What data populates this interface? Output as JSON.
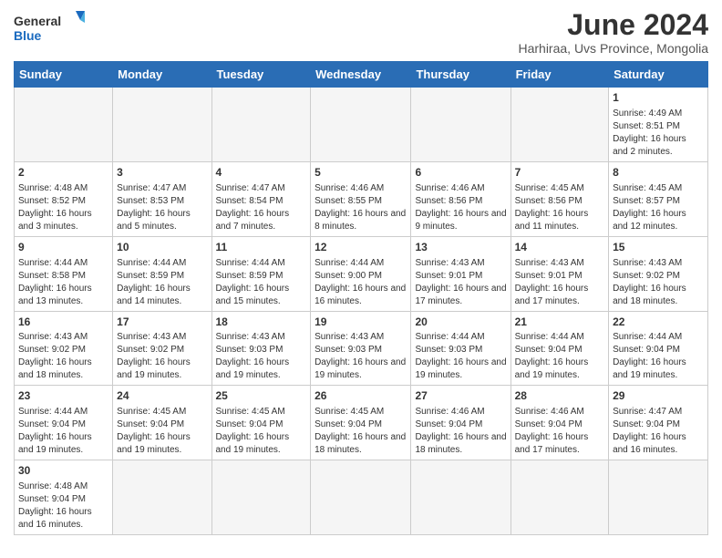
{
  "logo": {
    "text_general": "General",
    "text_blue": "Blue"
  },
  "title": "June 2024",
  "subtitle": "Harhiraa, Uvs Province, Mongolia",
  "days_of_week": [
    "Sunday",
    "Monday",
    "Tuesday",
    "Wednesday",
    "Thursday",
    "Friday",
    "Saturday"
  ],
  "weeks": [
    [
      {
        "day": "",
        "info": ""
      },
      {
        "day": "",
        "info": ""
      },
      {
        "day": "",
        "info": ""
      },
      {
        "day": "",
        "info": ""
      },
      {
        "day": "",
        "info": ""
      },
      {
        "day": "",
        "info": ""
      },
      {
        "day": "1",
        "info": "Sunrise: 4:49 AM\nSunset: 8:51 PM\nDaylight: 16 hours and 2 minutes."
      }
    ],
    [
      {
        "day": "2",
        "info": "Sunrise: 4:48 AM\nSunset: 8:52 PM\nDaylight: 16 hours and 3 minutes."
      },
      {
        "day": "3",
        "info": "Sunrise: 4:47 AM\nSunset: 8:53 PM\nDaylight: 16 hours and 5 minutes."
      },
      {
        "day": "4",
        "info": "Sunrise: 4:47 AM\nSunset: 8:54 PM\nDaylight: 16 hours and 7 minutes."
      },
      {
        "day": "5",
        "info": "Sunrise: 4:46 AM\nSunset: 8:55 PM\nDaylight: 16 hours and 8 minutes."
      },
      {
        "day": "6",
        "info": "Sunrise: 4:46 AM\nSunset: 8:56 PM\nDaylight: 16 hours and 9 minutes."
      },
      {
        "day": "7",
        "info": "Sunrise: 4:45 AM\nSunset: 8:56 PM\nDaylight: 16 hours and 11 minutes."
      },
      {
        "day": "8",
        "info": "Sunrise: 4:45 AM\nSunset: 8:57 PM\nDaylight: 16 hours and 12 minutes."
      }
    ],
    [
      {
        "day": "9",
        "info": "Sunrise: 4:44 AM\nSunset: 8:58 PM\nDaylight: 16 hours and 13 minutes."
      },
      {
        "day": "10",
        "info": "Sunrise: 4:44 AM\nSunset: 8:59 PM\nDaylight: 16 hours and 14 minutes."
      },
      {
        "day": "11",
        "info": "Sunrise: 4:44 AM\nSunset: 8:59 PM\nDaylight: 16 hours and 15 minutes."
      },
      {
        "day": "12",
        "info": "Sunrise: 4:44 AM\nSunset: 9:00 PM\nDaylight: 16 hours and 16 minutes."
      },
      {
        "day": "13",
        "info": "Sunrise: 4:43 AM\nSunset: 9:01 PM\nDaylight: 16 hours and 17 minutes."
      },
      {
        "day": "14",
        "info": "Sunrise: 4:43 AM\nSunset: 9:01 PM\nDaylight: 16 hours and 17 minutes."
      },
      {
        "day": "15",
        "info": "Sunrise: 4:43 AM\nSunset: 9:02 PM\nDaylight: 16 hours and 18 minutes."
      }
    ],
    [
      {
        "day": "16",
        "info": "Sunrise: 4:43 AM\nSunset: 9:02 PM\nDaylight: 16 hours and 18 minutes."
      },
      {
        "day": "17",
        "info": "Sunrise: 4:43 AM\nSunset: 9:02 PM\nDaylight: 16 hours and 19 minutes."
      },
      {
        "day": "18",
        "info": "Sunrise: 4:43 AM\nSunset: 9:03 PM\nDaylight: 16 hours and 19 minutes."
      },
      {
        "day": "19",
        "info": "Sunrise: 4:43 AM\nSunset: 9:03 PM\nDaylight: 16 hours and 19 minutes."
      },
      {
        "day": "20",
        "info": "Sunrise: 4:44 AM\nSunset: 9:03 PM\nDaylight: 16 hours and 19 minutes."
      },
      {
        "day": "21",
        "info": "Sunrise: 4:44 AM\nSunset: 9:04 PM\nDaylight: 16 hours and 19 minutes."
      },
      {
        "day": "22",
        "info": "Sunrise: 4:44 AM\nSunset: 9:04 PM\nDaylight: 16 hours and 19 minutes."
      }
    ],
    [
      {
        "day": "23",
        "info": "Sunrise: 4:44 AM\nSunset: 9:04 PM\nDaylight: 16 hours and 19 minutes."
      },
      {
        "day": "24",
        "info": "Sunrise: 4:45 AM\nSunset: 9:04 PM\nDaylight: 16 hours and 19 minutes."
      },
      {
        "day": "25",
        "info": "Sunrise: 4:45 AM\nSunset: 9:04 PM\nDaylight: 16 hours and 19 minutes."
      },
      {
        "day": "26",
        "info": "Sunrise: 4:45 AM\nSunset: 9:04 PM\nDaylight: 16 hours and 18 minutes."
      },
      {
        "day": "27",
        "info": "Sunrise: 4:46 AM\nSunset: 9:04 PM\nDaylight: 16 hours and 18 minutes."
      },
      {
        "day": "28",
        "info": "Sunrise: 4:46 AM\nSunset: 9:04 PM\nDaylight: 16 hours and 17 minutes."
      },
      {
        "day": "29",
        "info": "Sunrise: 4:47 AM\nSunset: 9:04 PM\nDaylight: 16 hours and 16 minutes."
      }
    ],
    [
      {
        "day": "30",
        "info": "Sunrise: 4:48 AM\nSunset: 9:04 PM\nDaylight: 16 hours and 16 minutes."
      },
      {
        "day": "",
        "info": ""
      },
      {
        "day": "",
        "info": ""
      },
      {
        "day": "",
        "info": ""
      },
      {
        "day": "",
        "info": ""
      },
      {
        "day": "",
        "info": ""
      },
      {
        "day": "",
        "info": ""
      }
    ]
  ]
}
